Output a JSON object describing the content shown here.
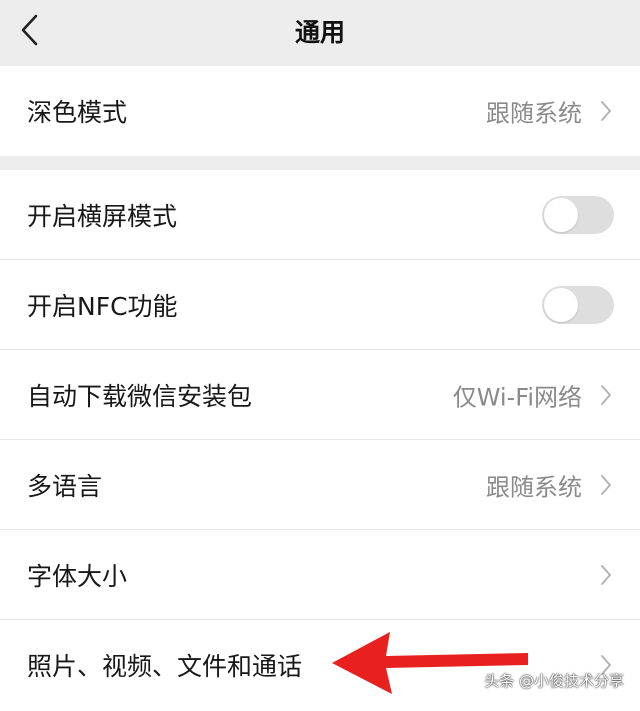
{
  "header": {
    "title": "通用",
    "back_icon": "chevron-left-icon"
  },
  "group1": {
    "dark_mode": {
      "label": "深色模式",
      "value": "跟随系统"
    }
  },
  "group2": {
    "landscape": {
      "label": "开启横屏模式",
      "toggle_on": false
    },
    "nfc": {
      "label": "开启NFC功能",
      "toggle_on": false
    },
    "auto_download": {
      "label": "自动下载微信安装包",
      "value": "仅Wi-Fi网络"
    },
    "language": {
      "label": "多语言",
      "value": "跟随系统"
    },
    "font_size": {
      "label": "字体大小"
    },
    "media": {
      "label": "照片、视频、文件和通话"
    }
  },
  "annotation": {
    "arrow_color": "#e8201e"
  },
  "watermark": {
    "text": "头条 @小俊技术分享"
  },
  "colors": {
    "background": "#ededed",
    "card": "#ffffff",
    "secondary_text": "#8a8a8a",
    "toggle_off": "#dedede"
  }
}
